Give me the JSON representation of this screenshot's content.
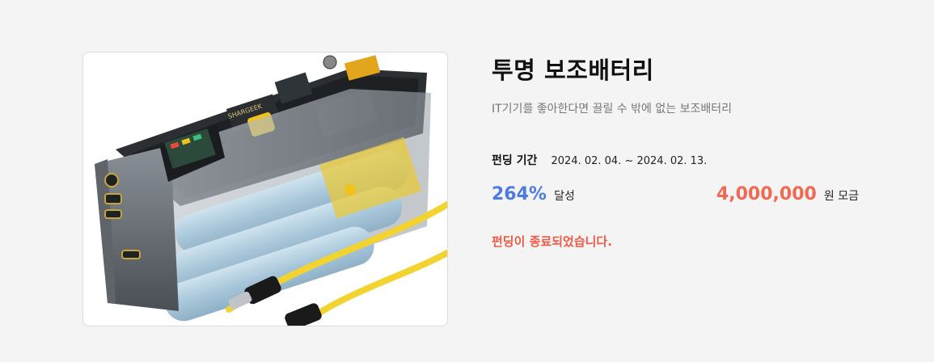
{
  "product": {
    "title": "투명 보조배터리",
    "subtitle": "IT기기를 좋아한다면 끌릴 수 밖에 없는 보조배터리",
    "image_brand_text": "SHARGEEK",
    "funding_period": {
      "label": "펀딩 기간",
      "value": "2024. 02. 04. ~ 2024. 02. 13."
    },
    "achievement": {
      "value": "264%",
      "label": "달성"
    },
    "amount": {
      "value": "4,000,000",
      "label": "원 모금"
    },
    "status_message": "펀딩이 종료되었습니다."
  },
  "colors": {
    "background": "#f4f4f4",
    "achievement": "#4d7be3",
    "amount": "#f06a53",
    "status": "#ef5a45",
    "subtitle": "#777777"
  },
  "icons": [
    "power-bank-product-image"
  ]
}
